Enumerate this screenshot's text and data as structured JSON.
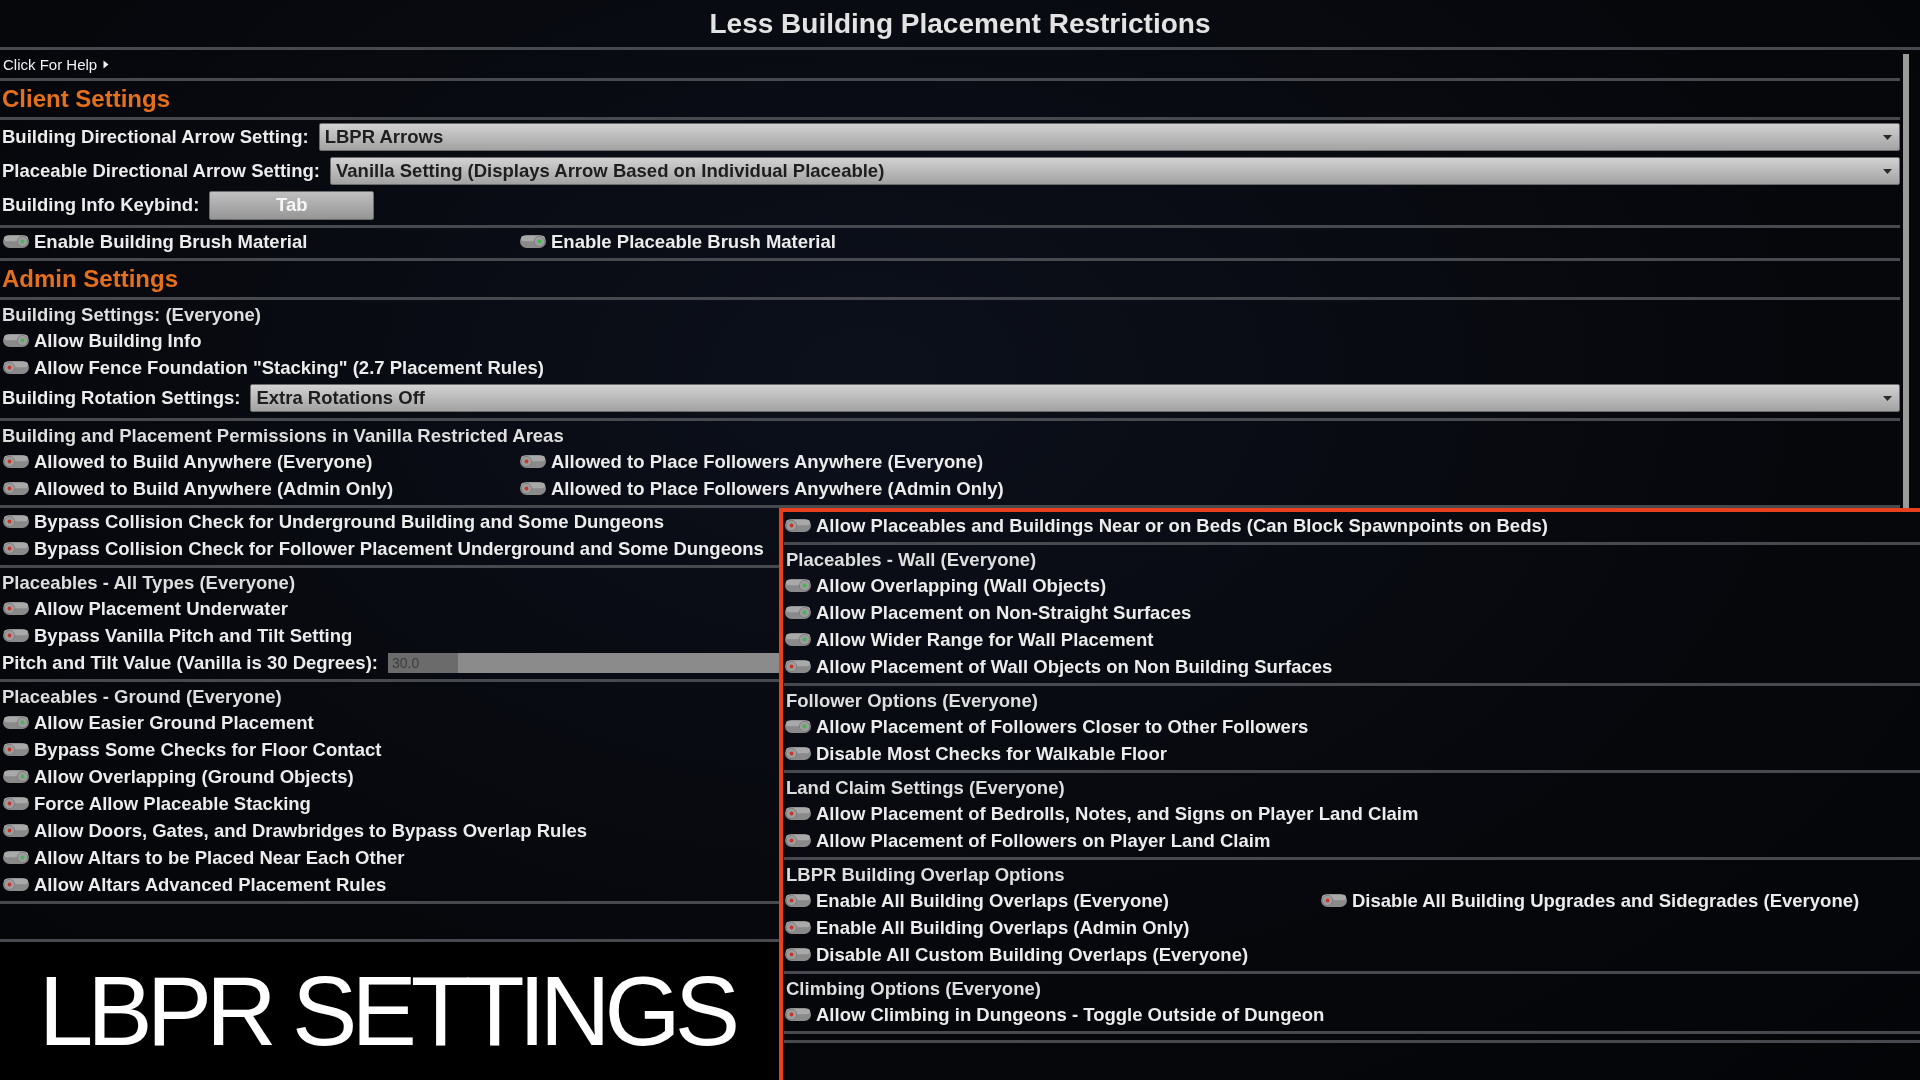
{
  "window": {
    "title": "Less Building Placement Restrictions"
  },
  "help_link": {
    "label": "Click For Help",
    "expanded": false
  },
  "client_settings": {
    "title": "Client Settings",
    "groups": [
      {
        "rows": [
          {
            "kind": "dropdown",
            "label": "Building Directional Arrow Setting:",
            "value": "LBPR Arrows"
          },
          {
            "kind": "dropdown",
            "label": "Placeable Directional Arrow Setting:",
            "value": "Vanilla Setting (Displays Arrow Based on Individual Placeable)"
          },
          {
            "kind": "keybind",
            "label": "Building Info Keybind:",
            "value": "Tab"
          }
        ]
      },
      {
        "rows": [
          {
            "kind": "toggles",
            "toggles": [
              {
                "label": "Enable Building Brush Material",
                "on": true
              },
              {
                "label": "Enable Placeable Brush Material",
                "on": true
              }
            ]
          }
        ]
      }
    ]
  },
  "admin_settings": {
    "title": "Admin Settings",
    "groups": [
      {
        "heading": "Building Settings: (Everyone)",
        "rows": [
          {
            "kind": "toggles",
            "toggles": [
              {
                "label": "Allow Building Info",
                "on": true
              }
            ]
          },
          {
            "kind": "toggles",
            "toggles": [
              {
                "label": "Allow Fence Foundation \"Stacking\" (2.7 Placement Rules)",
                "on": false
              }
            ]
          },
          {
            "kind": "dropdown",
            "label": "Building Rotation Settings:",
            "value": "Extra Rotations Off"
          }
        ]
      },
      {
        "heading": "Building and Placement Permissions in Vanilla Restricted Areas",
        "rows": [
          {
            "kind": "toggles",
            "toggles": [
              {
                "label": "Allowed to Build Anywhere (Everyone)",
                "on": false
              },
              {
                "label": "Allowed to Place Followers Anywhere (Everyone)",
                "on": false
              }
            ]
          },
          {
            "kind": "toggles",
            "toggles": [
              {
                "label": "Allowed to Build Anywhere (Admin Only)",
                "on": false
              },
              {
                "label": "Allowed to Place Followers Anywhere (Admin Only)",
                "on": false
              }
            ]
          }
        ]
      }
    ]
  },
  "left_column": {
    "groups": [
      {
        "rows": [
          {
            "kind": "toggles",
            "toggles": [
              {
                "label": "Bypass Collision Check for Underground Building and Some Dungeons",
                "on": false
              }
            ]
          },
          {
            "kind": "toggles",
            "toggles": [
              {
                "label": "Bypass Collision Check for Follower Placement Underground and Some Dungeons",
                "on": false
              }
            ]
          }
        ]
      },
      {
        "heading": "Placeables - All Types (Everyone)",
        "rows": [
          {
            "kind": "toggles",
            "toggles": [
              {
                "label": "Allow Placement Underwater",
                "on": false
              }
            ]
          },
          {
            "kind": "toggles",
            "toggles": [
              {
                "label": "Bypass Vanilla Pitch and Tilt Setting",
                "on": false
              }
            ]
          },
          {
            "kind": "slider",
            "label": "Pitch and Tilt Value (Vanilla is 30 Degrees):",
            "value": "30.0",
            "level": 0.18
          }
        ]
      },
      {
        "heading": "Placeables - Ground (Everyone)",
        "rows": [
          {
            "kind": "toggles",
            "toggles": [
              {
                "label": "Allow Easier Ground Placement",
                "on": true
              }
            ]
          },
          {
            "kind": "toggles",
            "toggles": [
              {
                "label": "Bypass Some Checks for Floor Contact",
                "on": false
              }
            ]
          },
          {
            "kind": "toggles",
            "toggles": [
              {
                "label": "Allow Overlapping (Ground Objects)",
                "on": true
              }
            ]
          },
          {
            "kind": "toggles",
            "toggles": [
              {
                "label": "Force Allow Placeable Stacking",
                "on": false
              }
            ]
          },
          {
            "kind": "toggles",
            "toggles": [
              {
                "label": "Allow Doors, Gates, and Drawbridges to Bypass Overlap Rules",
                "on": false
              }
            ]
          },
          {
            "kind": "toggles",
            "toggles": [
              {
                "label": "Allow Altars to be Placed Near Each Other",
                "on": true
              }
            ]
          },
          {
            "kind": "toggles",
            "toggles": [
              {
                "label": "Allow Altars Advanced Placement Rules",
                "on": false
              }
            ]
          }
        ]
      }
    ]
  },
  "right_column": {
    "highlighted": true,
    "groups": [
      {
        "rows": [
          {
            "kind": "toggles",
            "toggles": [
              {
                "label": "Allow Placeables and Buildings Near or on Beds (Can Block Spawnpoints on Beds)",
                "on": false
              }
            ]
          }
        ]
      },
      {
        "heading": "Placeables - Wall (Everyone)",
        "rows": [
          {
            "kind": "toggles",
            "toggles": [
              {
                "label": "Allow Overlapping (Wall Objects)",
                "on": true
              }
            ]
          },
          {
            "kind": "toggles",
            "toggles": [
              {
                "label": "Allow Placement on Non-Straight Surfaces",
                "on": true
              }
            ]
          },
          {
            "kind": "toggles",
            "toggles": [
              {
                "label": "Allow Wider Range for Wall Placement",
                "on": true
              }
            ]
          },
          {
            "kind": "toggles",
            "toggles": [
              {
                "label": "Allow Placement of Wall Objects on Non Building Surfaces",
                "on": false
              }
            ]
          }
        ]
      },
      {
        "heading": "Follower Options (Everyone)",
        "rows": [
          {
            "kind": "toggles",
            "toggles": [
              {
                "label": "Allow Placement of Followers Closer to Other Followers",
                "on": true
              }
            ]
          },
          {
            "kind": "toggles",
            "toggles": [
              {
                "label": "Disable Most Checks for Walkable Floor",
                "on": false
              }
            ]
          }
        ]
      },
      {
        "heading": "Land Claim Settings (Everyone)",
        "rows": [
          {
            "kind": "toggles",
            "toggles": [
              {
                "label": "Allow Placement of Bedrolls, Notes, and Signs on Player Land Claim",
                "on": false
              }
            ]
          },
          {
            "kind": "toggles",
            "toggles": [
              {
                "label": "Allow Placement of Followers on Player Land Claim",
                "on": false
              }
            ]
          }
        ]
      },
      {
        "heading": "LBPR Building Overlap Options",
        "rows": [
          {
            "kind": "toggles",
            "toggles": [
              {
                "label": "Enable All Building Overlaps (Everyone)",
                "on": false
              },
              {
                "label": "Disable All Building Upgrades and Sidegrades (Everyone)",
                "on": false
              }
            ]
          },
          {
            "kind": "toggles",
            "toggles": [
              {
                "label": "Enable All Building Overlaps (Admin Only)",
                "on": false
              }
            ]
          },
          {
            "kind": "toggles",
            "toggles": [
              {
                "label": "Disable All Custom Building Overlaps (Everyone)",
                "on": false
              }
            ]
          }
        ]
      },
      {
        "heading": "Climbing Options (Everyone)",
        "rows": [
          {
            "kind": "toggles",
            "toggles": [
              {
                "label": "Allow Climbing in Dungeons - Toggle Outside of Dungeon",
                "on": false
              }
            ]
          }
        ]
      }
    ]
  },
  "caption": {
    "text": "LBPR SETTINGS"
  }
}
